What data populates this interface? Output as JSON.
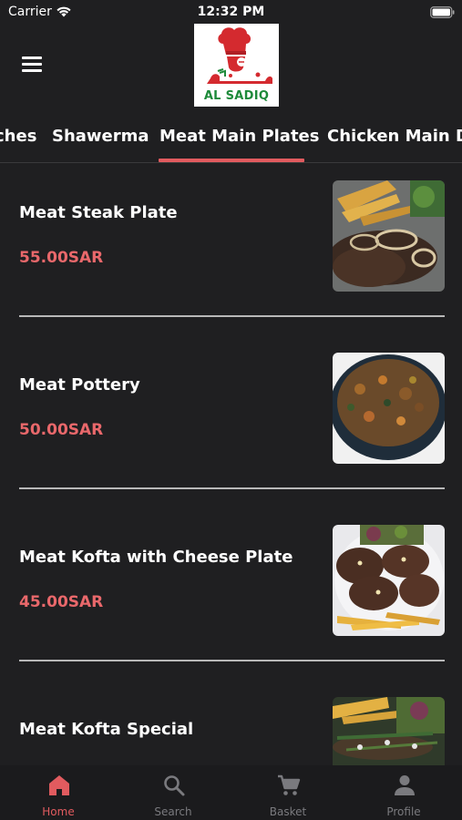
{
  "status": {
    "carrier": "Carrier",
    "time": "12:32 PM"
  },
  "header": {
    "logo_arabic": "الصادق",
    "logo_latin": "AL SADIQ"
  },
  "tabs": [
    {
      "label": "ches",
      "active": false
    },
    {
      "label": "Shawerma",
      "active": false
    },
    {
      "label": "Meat Main Plates",
      "active": true
    },
    {
      "label": "Chicken Main Di",
      "active": false
    }
  ],
  "items": [
    {
      "name": "Meat Steak Plate",
      "price": "55.00SAR",
      "image_icon": "steak-plate-photo"
    },
    {
      "name": "Meat Pottery",
      "price": "50.00SAR",
      "image_icon": "pottery-photo"
    },
    {
      "name": "Meat Kofta with Cheese Plate",
      "price": "45.00SAR",
      "image_icon": "kofta-cheese-photo"
    },
    {
      "name": "Meat Kofta Special",
      "price": "",
      "image_icon": "kofta-special-photo"
    }
  ],
  "nav": [
    {
      "label": "Home",
      "icon": "home-icon",
      "active": true
    },
    {
      "label": "Search",
      "icon": "search-icon",
      "active": false
    },
    {
      "label": "Basket",
      "icon": "cart-icon",
      "active": false
    },
    {
      "label": "Profile",
      "icon": "profile-icon",
      "active": false
    }
  ],
  "colors": {
    "background": "#1f1f21",
    "accent": "#e15b5f",
    "price": "#e9686b",
    "nav_inactive": "#7a7a7e"
  }
}
